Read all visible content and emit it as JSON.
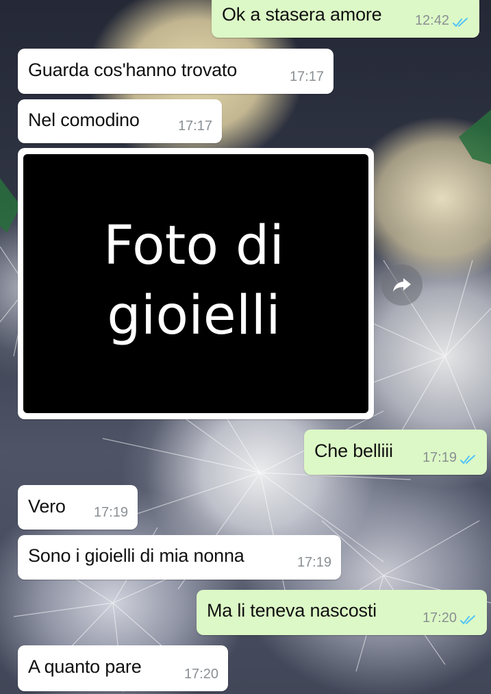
{
  "messages": [
    {
      "text": "Ok a stasera amore",
      "time": "12:42",
      "direction": "outgoing",
      "status": "read"
    },
    {
      "text": "Guarda cos'hanno trovato",
      "time": "17:17",
      "direction": "incoming"
    },
    {
      "text": "Nel comodino",
      "time": "17:17",
      "direction": "incoming"
    },
    {
      "text": "Che belliii",
      "time": "17:19",
      "direction": "outgoing",
      "status": "read"
    },
    {
      "text": "Vero",
      "time": "17:19",
      "direction": "incoming"
    },
    {
      "text": "Sono i gioielli di mia nonna",
      "time": "17:19",
      "direction": "incoming"
    },
    {
      "text": "Ma li teneva nascosti",
      "time": "17:20",
      "direction": "outgoing",
      "status": "read"
    },
    {
      "text": "A quanto pare",
      "time": "17:20",
      "direction": "incoming"
    }
  ],
  "photo": {
    "caption": "Foto di\ngioielli"
  },
  "icons": {
    "read_receipt": "double-check-icon",
    "forward": "forward-arrow-icon"
  },
  "colors": {
    "incoming_bubble": "#ffffff",
    "outgoing_bubble": "#dcf8c6",
    "timestamp": "#8a8f93",
    "read_tick": "#4fc3f7",
    "photo_background": "#000000"
  }
}
